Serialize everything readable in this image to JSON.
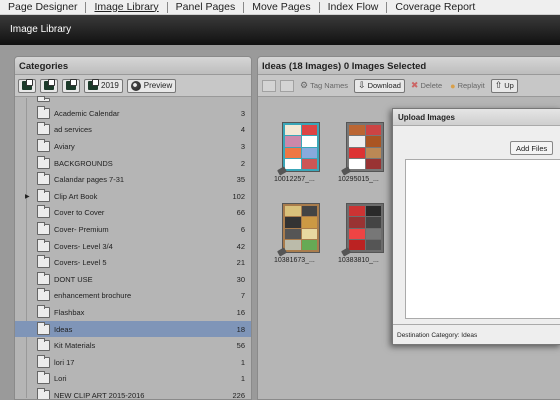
{
  "nav": {
    "items": [
      "Page Designer",
      "Image Library",
      "Panel Pages",
      "Move Pages",
      "Index Flow",
      "Coverage Report"
    ],
    "active": "Image Library"
  },
  "title_bar": "Image Library",
  "categories": {
    "header": "Categories",
    "toolbar": {
      "year_label": "2019",
      "preview_label": "Preview"
    },
    "items": [
      {
        "name": "",
        "count": ""
      },
      {
        "name": "Academic Calendar",
        "count": "3"
      },
      {
        "name": "ad services",
        "count": "4"
      },
      {
        "name": "Aviary",
        "count": "3"
      },
      {
        "name": "BACKGROUNDS",
        "count": "2"
      },
      {
        "name": "Calandar pages 7-31",
        "count": "35"
      },
      {
        "name": "Clip Art Book",
        "count": "102",
        "expandable": true
      },
      {
        "name": "Cover to Cover",
        "count": "66"
      },
      {
        "name": "Cover- Premium",
        "count": "6"
      },
      {
        "name": "Covers- Level 3/4",
        "count": "42"
      },
      {
        "name": "Covers- Level 5",
        "count": "21"
      },
      {
        "name": "DONT USE",
        "count": "30"
      },
      {
        "name": "enhancement brochure",
        "count": "7"
      },
      {
        "name": "Flashbax",
        "count": "16"
      },
      {
        "name": "Ideas",
        "count": "18",
        "selected": true
      },
      {
        "name": "Kit Materials",
        "count": "56"
      },
      {
        "name": "lori 17",
        "count": "1"
      },
      {
        "name": "Lori",
        "count": "1"
      },
      {
        "name": "NEW CLIP ART 2015-2016",
        "count": "226"
      }
    ]
  },
  "images": {
    "header": "Ideas (18 Images) 0 Images Selected",
    "toolbar": {
      "tag_names": "Tag Names",
      "download": "Download",
      "delete": "Delete",
      "replayit": "Replayit",
      "upload": "Up"
    },
    "thumbs": [
      {
        "caption": "10012257_..."
      },
      {
        "caption": "10295015_..."
      },
      {
        "caption": "10381673_..."
      },
      {
        "caption": "103838​10_..."
      }
    ]
  },
  "upload": {
    "title": "Upload Images",
    "add_files": "Add Files",
    "destination": "Destination Category: Ideas"
  }
}
